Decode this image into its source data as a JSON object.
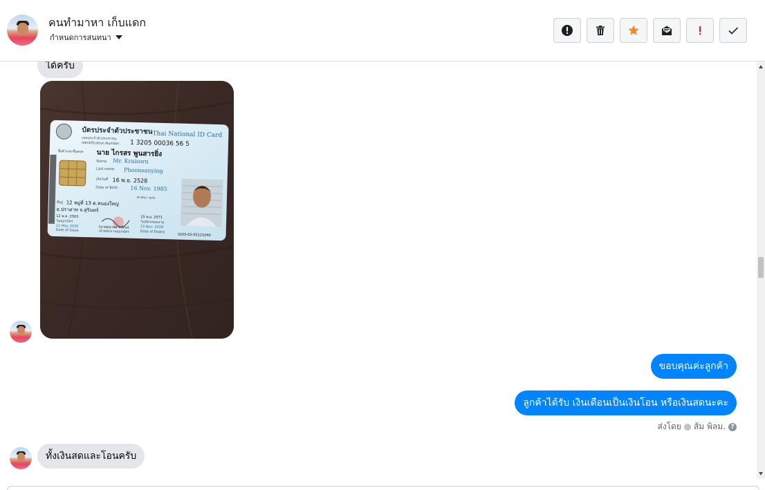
{
  "header": {
    "contact_name": "คนทำมาหา เก็บแดก",
    "assign_label": "กำหนดการสนทนา",
    "toolbar": [
      {
        "name": "report-spam",
        "icon": "alert-circle-icon"
      },
      {
        "name": "delete",
        "icon": "trash-icon"
      },
      {
        "name": "star",
        "icon": "star-icon"
      },
      {
        "name": "mark-unread",
        "icon": "envelope-icon"
      },
      {
        "name": "flag",
        "icon": "exclamation-icon"
      },
      {
        "name": "mark-done",
        "icon": "checkmark-icon"
      }
    ]
  },
  "messages": {
    "incoming_1": "ได้ครับ",
    "outgoing_1": "ขอบคุณค่ะลูกค้า",
    "outgoing_2": "ลูกค้าได้รับ เงินเดือนเป็นเงินโอน หรือเงินสดนะคะ",
    "incoming_2": "ทั้งเงินสดและโอนครับ"
  },
  "id_card": {
    "title_th": "บัตรประจำตัวประชาชน",
    "title_en": "Thai National ID Card",
    "id_label_th": "เลขประจำตัวประชาชน",
    "id_label_en": "Identification Number",
    "id_number": "1 3205 00036 56 5",
    "name_label_th": "ชื่อตัวและชื่อสกุล",
    "name_th": "นาย ไกรสร พูนสารยิ่ง",
    "name_label_en": "Name",
    "name_en": "Mr. Kraisorn",
    "last_label_en": "Last name",
    "last_en": "Phoonsanying",
    "dob_label_th": "เกิดวันที่",
    "dob_th": "16 พ.ย. 2528",
    "dob_label_en": "Date of Birth",
    "dob_en": "16 Nov. 1985",
    "religion_label": "ศาสนา",
    "religion": "พุทธ",
    "address_label": "ที่อยู่",
    "address_1": "12 หมู่ที่ 13 ต.หนองใหญ่",
    "address_2": "อ.ปราสาท จ.สุรินทร์",
    "issue_th": "12 พ.ค. 2563",
    "issue_label_th": "วันออกบัตร",
    "issue_en": "12 May 2020",
    "issue_label_en": "Date of Issue",
    "officer": "(นายธนาพล จงจิรง)",
    "officer_title": "เจ้าพนักงานออกบัตร",
    "expiry_th": "15 พ.ย. 2571",
    "expiry_label_th": "วันบัตรหมดอายุ",
    "expiry_en": "15 Nov. 2028",
    "expiry_label_en": "Date of Expiry",
    "serial": "3205-02-05121040"
  },
  "sent_by": {
    "prefix": "ส่งโดย",
    "agent": "ส้ม พิลม."
  }
}
